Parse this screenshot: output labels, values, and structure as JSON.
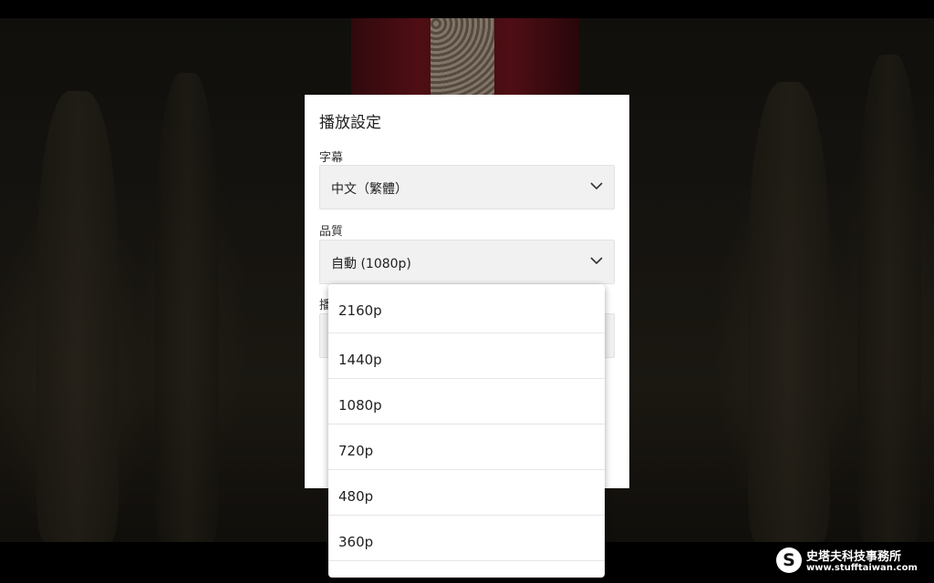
{
  "settings": {
    "title": "播放設定",
    "subtitle_label": "字幕",
    "subtitle_value": "中文（繁體）",
    "quality_label": "品質",
    "quality_value": "自動 (1080p)",
    "playback_label_partial": "播"
  },
  "quality_options": [
    "2160p",
    "1440p",
    "1080p",
    "720p",
    "480p",
    "360p"
  ],
  "watermark": {
    "logo_letter": "S",
    "name": "史塔夫科技事務所",
    "url": "www.stufftaiwan.com"
  },
  "colors": {
    "panel_bg": "#ffffff",
    "select_bg": "#f1f1f1",
    "text": "#222222"
  }
}
